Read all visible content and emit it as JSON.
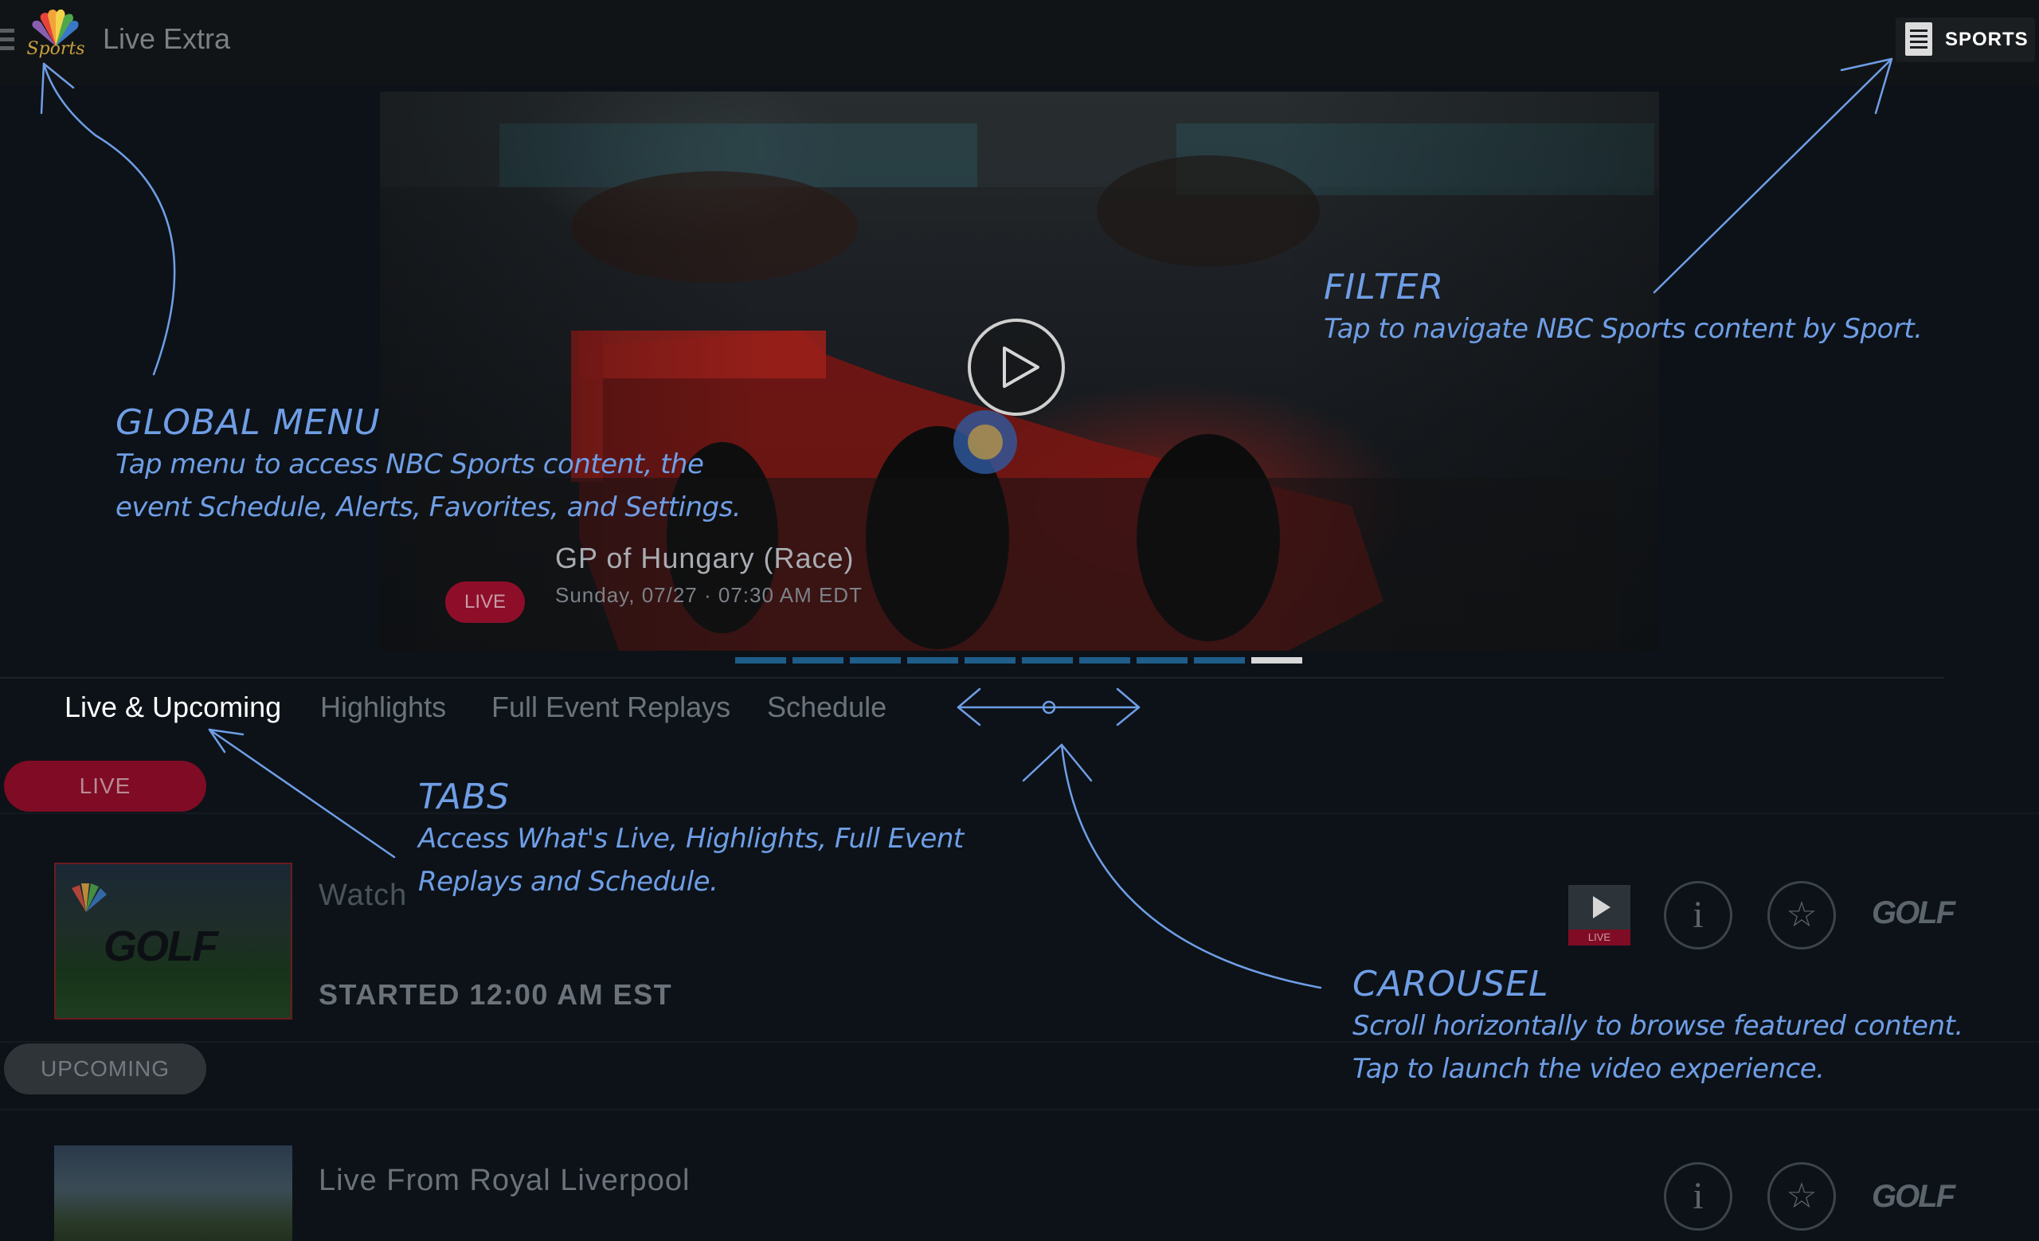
{
  "app": {
    "title": "Live Extra",
    "logo_text": "Sports",
    "filter_label": "SPORTS"
  },
  "hero": {
    "badge": "LIVE",
    "title": "GP of Hungary (Race)",
    "subtitle": "Sunday, 07/27 · 07:30 AM EDT",
    "slide_count": 10,
    "active_slide": 10
  },
  "tabs": [
    {
      "label": "Live & Upcoming",
      "selected": true
    },
    {
      "label": "Highlights",
      "selected": false
    },
    {
      "label": "Full Event Replays",
      "selected": false
    },
    {
      "label": "Schedule",
      "selected": false
    }
  ],
  "sections": {
    "live_label": "LIVE",
    "upcoming_label": "UPCOMING"
  },
  "rows": [
    {
      "title": "Watch",
      "status": "STARTED 12:00 AM EST",
      "thumb_logo": "GOLF",
      "live_badge": "LIVE",
      "info_glyph": "i",
      "fav_glyph": "☆",
      "channel": "GOLF"
    },
    {
      "title": "Live From Royal Liverpool",
      "info_glyph": "i",
      "fav_glyph": "☆",
      "channel": "GOLF"
    }
  ],
  "annotations": {
    "global_menu": {
      "title": "GLOBAL MENU",
      "lines": [
        "Tap menu to access NBC Sports content, the",
        "event Schedule, Alerts, Favorites, and Settings."
      ]
    },
    "filter": {
      "title": "FILTER",
      "lines": [
        "Tap to navigate NBC Sports content by Sport."
      ]
    },
    "tabs": {
      "title": "TABS",
      "lines": [
        "Access What's Live, Highlights, Full Event",
        "Replays and Schedule."
      ]
    },
    "carousel": {
      "title": "CAROUSEL",
      "lines": [
        "Scroll horizontally to browse featured content.",
        "Tap to launch the video experience."
      ]
    }
  },
  "colors": {
    "annotation": "#6f9ee6",
    "live_red": "#8e0e2a",
    "pager_blue": "#1f5d8a",
    "background": "#0c1218"
  },
  "icons": [
    "menu-icon",
    "nbc-peacock-logo",
    "filter-list-icon",
    "play-icon",
    "info-icon",
    "star-icon",
    "swipe-arrows-icon"
  ]
}
